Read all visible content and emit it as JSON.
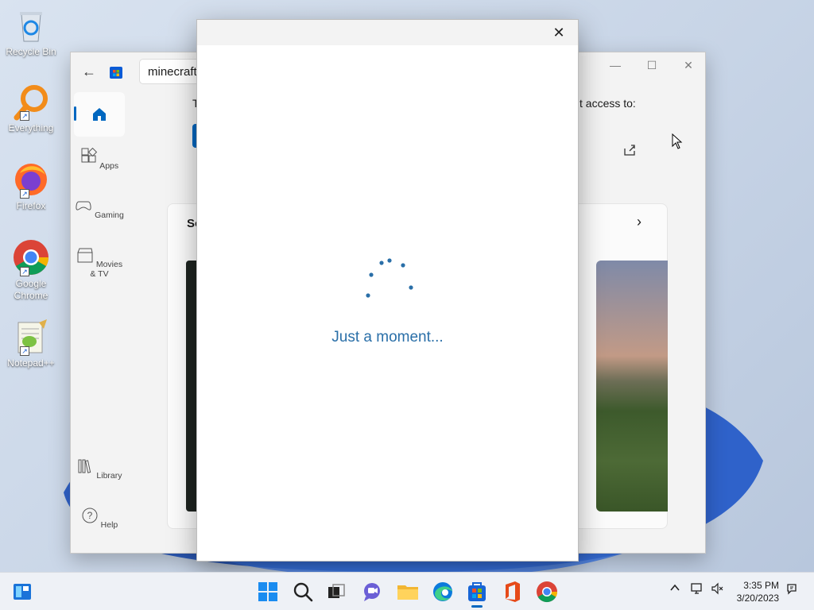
{
  "desktop": {
    "icons": [
      {
        "label": "Recycle Bin"
      },
      {
        "label": "Everything"
      },
      {
        "label": "Firefox"
      },
      {
        "label": "Google Chrome"
      },
      {
        "label": "Notepad++"
      }
    ]
  },
  "store": {
    "search_value": "minecraft",
    "nav": {
      "apps": "Apps",
      "gaming": "Gaming",
      "movies": "Movies & TV",
      "library": "Library",
      "help": "Help"
    },
    "partial_text_left": "T",
    "partial_text_right": "t access to:",
    "section_partial": "So"
  },
  "dialog": {
    "loading_text": "Just a moment..."
  },
  "taskbar": {
    "time": "3:35 PM",
    "date": "3/20/2023"
  },
  "colors": {
    "accent": "#0067c0",
    "loading_text": "#2a6fa8"
  }
}
